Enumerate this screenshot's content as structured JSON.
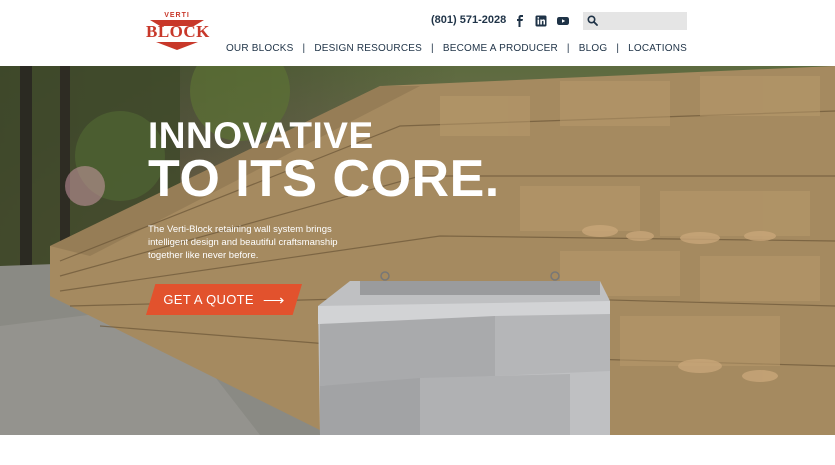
{
  "logo": {
    "top_text": "VERTI",
    "main_text": "BLOCK"
  },
  "header": {
    "phone": "(801) 571-2028",
    "search": {
      "placeholder": ""
    },
    "icons": [
      "facebook-icon",
      "linkedin-icon",
      "youtube-icon",
      "search-icon"
    ]
  },
  "nav": {
    "items": [
      {
        "label": "OUR BLOCKS"
      },
      {
        "label": "DESIGN RESOURCES"
      },
      {
        "label": "BECOME A PRODUCER"
      },
      {
        "label": "BLOG"
      },
      {
        "label": "LOCATIONS"
      }
    ],
    "separator": "|"
  },
  "hero": {
    "title_line1": "INNOVATIVE",
    "title_line2": "TO ITS CORE.",
    "body": "The Verti-Block retaining wall system brings intelligent design and beautiful craftsmanship together like never before.",
    "cta_label": "GET A QUOTE",
    "cta_arrow": "⟶"
  },
  "colors": {
    "brand_red": "#c8382a",
    "cta_orange": "#e2522d",
    "nav_text": "#1f3347"
  }
}
